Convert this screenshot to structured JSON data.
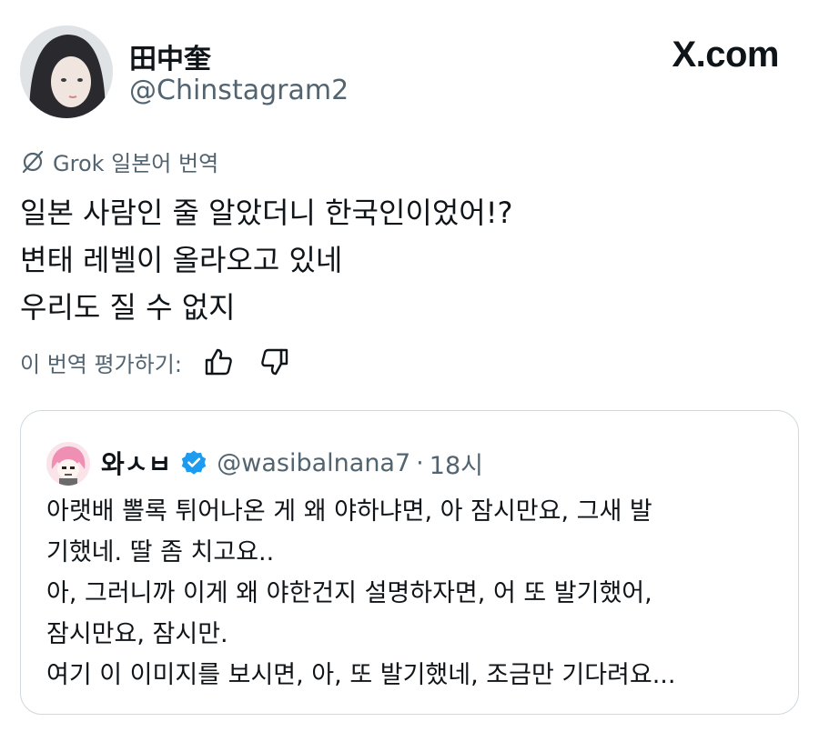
{
  "header": {
    "author_name": "田中奎",
    "author_handle": "@Chinstagram2",
    "brand": "X.com"
  },
  "translation": {
    "label": "Grok 일본어 번역",
    "lines": [
      "일본 사람인 줄 알았더니 한국인이었어!?",
      "변태 레벨이 올라오고 있네",
      "우리도 질 수 없지"
    ],
    "rate_label": "이 번역 평가하기:"
  },
  "quote": {
    "name": "와ㅅㅂ",
    "handle": "@wasibalnana7",
    "separator": "·",
    "time": "18시",
    "lines": [
      "아랫배 뽈록 튀어나온 게 왜 야하냐면, 아 잠시만요, 그새 발",
      "기했네. 딸 좀 치고요..",
      "아, 그러니까 이게 왜 야한건지 설명하자면, 어 또 발기했어,",
      "잠시만요, 잠시만.",
      "여기 이 이미지를 보시면, 아, 또 발기했네, 조금만 기다려요..."
    ]
  },
  "icons": {
    "grok": "grok-logo-icon",
    "thumbs_up": "thumbs-up-icon",
    "thumbs_down": "thumbs-down-icon",
    "verified": "verified-badge-icon"
  },
  "colors": {
    "text_primary": "#0f1419",
    "text_secondary": "#536471",
    "border": "#cfd9de",
    "verified_blue": "#1d9bf0"
  }
}
